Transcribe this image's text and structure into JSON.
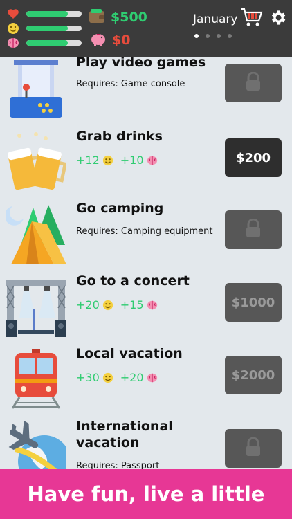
{
  "header": {
    "money": "$500",
    "savings": "$0",
    "month": "January",
    "page_dots": 4,
    "active_dot": 0,
    "stats": [
      {
        "name": "health",
        "icon": "heart-icon",
        "level": 0.75
      },
      {
        "name": "happiness",
        "icon": "smiley-icon",
        "level": 0.75
      },
      {
        "name": "smarts",
        "icon": "brain-icon",
        "level": 0.75
      }
    ]
  },
  "colors": {
    "topbar": "#3b3b3b",
    "green": "#2fcc71",
    "red": "#e74c3c",
    "pink": "#e73795",
    "list_bg": "#e3e8ec"
  },
  "items": [
    {
      "title": "Play video games",
      "requires": "Requires: Game console",
      "button": "locked",
      "icon": "arcade-icon"
    },
    {
      "title": "Grab drinks",
      "happiness": "+12",
      "smarts": "+10",
      "button": "$200",
      "icon": "beer-mugs-icon"
    },
    {
      "title": "Go camping",
      "requires": "Requires: Camping equipment",
      "button": "locked",
      "icon": "tent-icon"
    },
    {
      "title": "Go to a concert",
      "happiness": "+20",
      "smarts": "+15",
      "button": "$1000",
      "icon": "stage-icon"
    },
    {
      "title": "Local vacation",
      "happiness": "+30",
      "smarts": "+20",
      "button": "$2000",
      "icon": "train-icon"
    },
    {
      "title": "International vacation",
      "title_line1": "International",
      "title_line2": "vacation",
      "requires": "Requires: Passport",
      "button": "locked",
      "icon": "airplane-globe-icon"
    }
  ],
  "banner": "Have fun, live a little"
}
